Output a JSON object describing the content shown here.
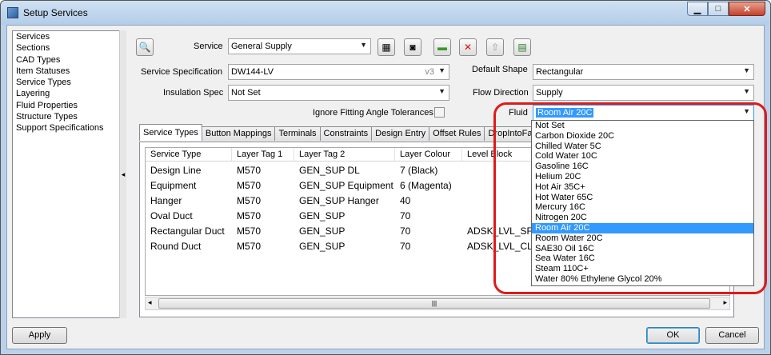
{
  "window": {
    "title": "Setup Services"
  },
  "sidebar": {
    "items": [
      "Services",
      "Sections",
      "CAD Types",
      "Item Statuses",
      "Service Types",
      "Layering",
      "Fluid Properties",
      "Structure Types",
      "Support Specifications"
    ]
  },
  "form": {
    "service_label": "Service",
    "service_value": "General Supply",
    "spec_label": "Service Specification",
    "spec_value": "DW144-LV",
    "spec_version": "v3",
    "insulation_label": "Insulation Spec",
    "insulation_value": "Not Set",
    "ignore_label": "Ignore Fitting Angle Tolerances",
    "shape_label": "Default Shape",
    "shape_value": "Rectangular",
    "flow_label": "Flow Direction",
    "flow_value": "Supply",
    "fluid_label": "Fluid",
    "fluid_value": "Room Air 20C"
  },
  "tabs": [
    "Service Types",
    "Button Mappings",
    "Terminals",
    "Constraints",
    "Design Entry",
    "Offset Rules",
    "DropIntoFall"
  ],
  "table": {
    "headers": [
      "Service Type",
      "Layer Tag 1",
      "Layer Tag 2",
      "Layer Colour",
      "Level Block"
    ],
    "rows": [
      [
        "Design Line",
        "M570",
        "GEN_SUP DL",
        "7 (Black)",
        ""
      ],
      [
        "Equipment",
        "M570",
        "GEN_SUP Equipment",
        "6 (Magenta)",
        ""
      ],
      [
        "Hanger",
        "M570",
        "GEN_SUP Hanger",
        "40",
        ""
      ],
      [
        "Oval Duct",
        "M570",
        "GEN_SUP",
        "70",
        ""
      ],
      [
        "Rectangular Duct",
        "M570",
        "GEN_SUP",
        "70",
        "ADSK_LVL_SFT"
      ],
      [
        "Round Duct",
        "M570",
        "GEN_SUP",
        "70",
        "ADSK_LVL_CL"
      ]
    ]
  },
  "fluid_options": [
    "Not Set",
    "Carbon Dioxide 20C",
    "Chilled Water 5C",
    "Cold Water 10C",
    "Gasoline 16C",
    "Helium 20C",
    "Hot Air 35C+",
    "Hot Water 65C",
    "Mercury 16C",
    "Nitrogen 20C",
    "Room Air 20C",
    "Room Water 20C",
    "SAE30 Oil 16C",
    "Sea Water 16C",
    "Steam 110C+",
    "Water 80% Ethylene Glycol 20%"
  ],
  "fluid_selected_index": 10,
  "buttons": {
    "apply": "Apply",
    "ok": "OK",
    "cancel": "Cancel"
  },
  "colors": {
    "highlight": "#e01a1a",
    "selection": "#3399ff"
  }
}
